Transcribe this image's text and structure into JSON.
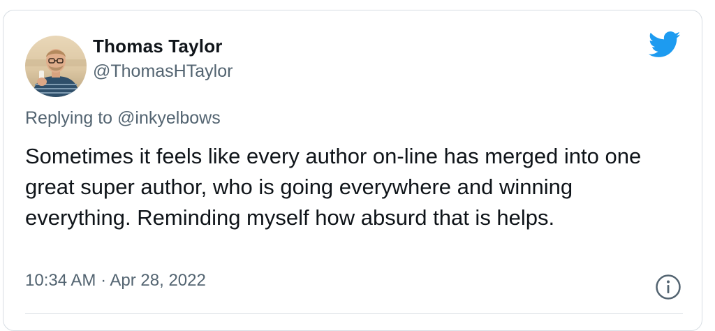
{
  "tweet": {
    "author_name": "Thomas Taylor",
    "author_handle": "@ThomasHTaylor",
    "replying_prefix": "Replying to",
    "replying_to": "@inkyelbows",
    "text": "Sometimes it feels like every author on-line has merged into one great super author, who is going everywhere and winning everything. Reminding myself how absurd that is helps.",
    "timestamp": "10:34 AM · Apr 28, 2022"
  },
  "icons": {
    "brand": "twitter-bird-icon",
    "info": "info-icon"
  },
  "colors": {
    "brand_blue": "#1d9bf0",
    "text_primary": "#0f1419",
    "text_secondary": "#536471",
    "border": "#d7dde3"
  }
}
